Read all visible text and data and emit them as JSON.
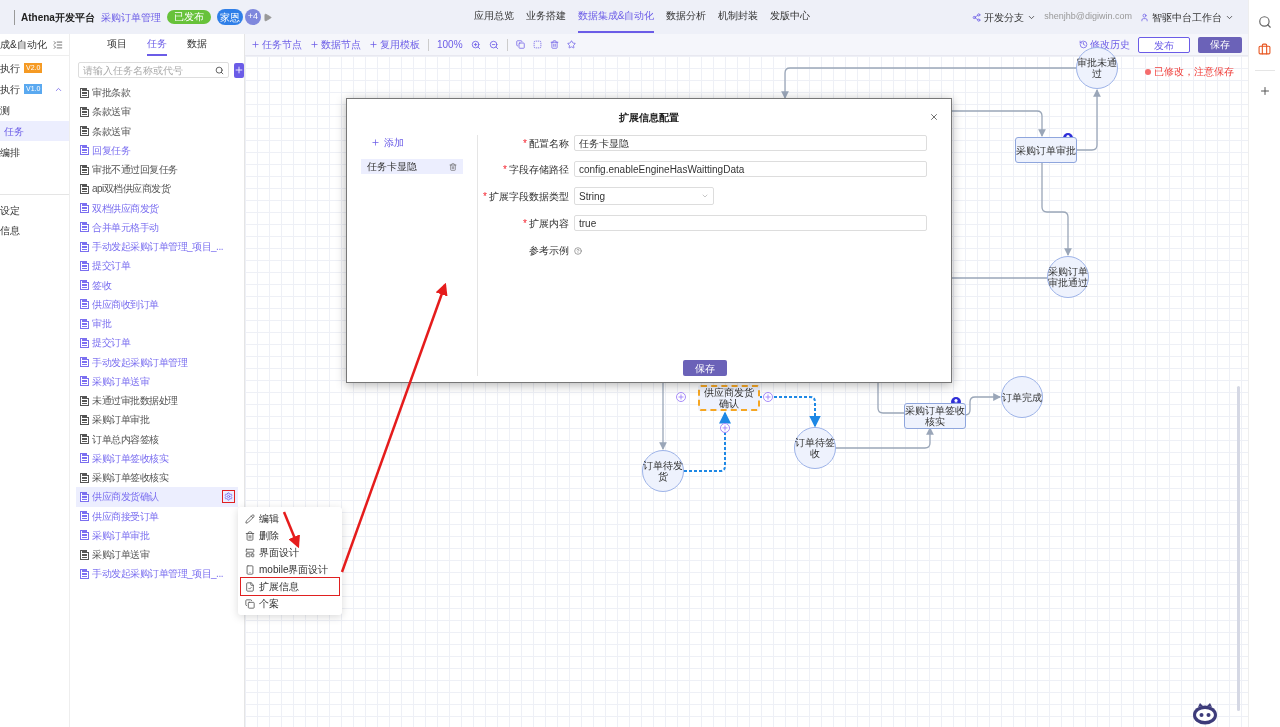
{
  "top_bar": {
    "brand": "Athena开发平台",
    "app_name": "采购订单管理",
    "status": "已发布",
    "avatar": "家恩",
    "more_count": "+4",
    "nav": [
      {
        "label": "应用总览",
        "selected": false
      },
      {
        "label": "业务搭建",
        "selected": false
      },
      {
        "label": "数据集成&自动化",
        "selected": true
      },
      {
        "label": "数据分析",
        "selected": false
      },
      {
        "label": "机制封装",
        "selected": false
      },
      {
        "label": "发版中心",
        "selected": false
      }
    ],
    "branch": "开发分支",
    "user": "shenjhb@digiwin.com",
    "workspace": "智驱中台工作台"
  },
  "sidebar": {
    "title": "成&自动化",
    "items": [
      {
        "label": "执行",
        "badge": "V2.0",
        "color": "#f59a23",
        "selected": false,
        "expanded": false
      },
      {
        "label": "执行",
        "badge": "V1.0",
        "color": "#5aa9f0",
        "selected": false,
        "expanded": true
      },
      {
        "label": "测",
        "selected": false
      },
      {
        "label": "任务",
        "selected": true
      },
      {
        "label": "编排",
        "selected": false
      }
    ],
    "bottom_items": [
      "设定",
      "信息"
    ]
  },
  "task_panel": {
    "tabs": [
      {
        "label": "项目",
        "selected": false
      },
      {
        "label": "任务",
        "selected": true
      },
      {
        "label": "数据",
        "selected": false
      }
    ],
    "search": {
      "placeholder": "请输入任务名称或代号"
    },
    "items": [
      {
        "label": "审批条款",
        "color": "#555555",
        "selected": false
      },
      {
        "label": "条款送审",
        "color": "#555555",
        "selected": false
      },
      {
        "label": "条款送审",
        "color": "#555555",
        "selected": false
      },
      {
        "label": "回复任务",
        "color": "#7b6ff0",
        "selected": false
      },
      {
        "label": "审批不通过回复任务",
        "color": "#555555",
        "selected": false
      },
      {
        "label": "api双档供应商发货",
        "color": "#555555",
        "selected": false
      },
      {
        "label": "双档供应商发货",
        "color": "#7b6ff0",
        "selected": false
      },
      {
        "label": "合并单元格手动",
        "color": "#7b6ff0",
        "selected": false
      },
      {
        "label": "手动发起采购订单管理_项目_...",
        "color": "#7b6ff0",
        "selected": false
      },
      {
        "label": "提交订单",
        "color": "#7b6ff0",
        "selected": false
      },
      {
        "label": "签收",
        "color": "#7b6ff0",
        "selected": false
      },
      {
        "label": "供应商收到订单",
        "color": "#7b6ff0",
        "selected": false
      },
      {
        "label": "审批",
        "color": "#7b6ff0",
        "selected": false
      },
      {
        "label": "提交订单",
        "color": "#7b6ff0",
        "selected": false
      },
      {
        "label": "手动发起采购订单管理",
        "color": "#7b6ff0",
        "selected": false
      },
      {
        "label": "采购订单送审",
        "color": "#7b6ff0",
        "selected": false
      },
      {
        "label": "未通过审批数据处理",
        "color": "#555555",
        "selected": false
      },
      {
        "label": "采购订单审批",
        "color": "#555555",
        "selected": false
      },
      {
        "label": "订单总内容签核",
        "color": "#555555",
        "selected": false
      },
      {
        "label": "采购订单签收核实",
        "color": "#7b6ff0",
        "selected": false
      },
      {
        "label": "采购订单签收核实",
        "color": "#555555",
        "selected": false
      },
      {
        "label": "供应商发货确认",
        "color": "#7b6ff0",
        "selected": true
      },
      {
        "label": "供应商接受订单",
        "color": "#7b6ff0",
        "selected": false
      },
      {
        "label": "采购订单审批",
        "color": "#7b6ff0",
        "selected": false
      },
      {
        "label": "采购订单送审",
        "color": "#555555",
        "selected": false
      },
      {
        "label": "手动发起采购订单管理_项目_...",
        "color": "#7b6ff0",
        "selected": false
      }
    ]
  },
  "context_menu": {
    "anchor_highlighted": true,
    "items": [
      {
        "label": "编辑",
        "kind": "edit",
        "highlighted": false
      },
      {
        "label": "删除",
        "kind": "delete",
        "highlighted": false
      },
      {
        "label": "界面设计",
        "kind": "layout",
        "highlighted": false
      },
      {
        "label": "mobile界面设计",
        "kind": "mobile",
        "highlighted": false
      },
      {
        "label": "扩展信息",
        "kind": "extend",
        "highlighted": true
      },
      {
        "label": "个案",
        "kind": "copy",
        "highlighted": false
      }
    ]
  },
  "toolbar": {
    "add_buttons": [
      "任务节点",
      "数据节点",
      "复用模板"
    ],
    "zoom": "100%",
    "history": "修改历史",
    "publish": "发布",
    "save": "保存"
  },
  "canvas": {
    "status": "已修改，注意保存",
    "nodes": [
      {
        "kind": "circle",
        "label": "审批未通过",
        "selected": false
      },
      {
        "kind": "task",
        "label": "采购订单审批",
        "selected": false
      },
      {
        "kind": "circle",
        "label": "采购订单审批通过",
        "selected": false
      },
      {
        "kind": "task",
        "label": "供应商发货确认",
        "selected": true
      },
      {
        "kind": "circle",
        "label": "订单待发货",
        "selected": false
      },
      {
        "kind": "circle",
        "label": "订单待签收",
        "selected": false
      },
      {
        "kind": "task",
        "label": "采购订单签收核实",
        "selected": false
      },
      {
        "kind": "circle",
        "label": "订单完成",
        "selected": false
      }
    ]
  },
  "dialog": {
    "title": "扩展信息配置",
    "add_label": "添加",
    "configs": [
      {
        "label": "任务卡显隐",
        "selected": true
      }
    ],
    "fields": [
      {
        "label": "配置名称",
        "required": true,
        "kind": "input",
        "value": "任务卡显隐"
      },
      {
        "label": "字段存储路径",
        "required": true,
        "kind": "input",
        "value": "config.enableEngineHasWaittingData"
      },
      {
        "label": "扩展字段数据类型",
        "required": true,
        "kind": "select",
        "value": "String"
      },
      {
        "label": "扩展内容",
        "required": true,
        "kind": "input",
        "value": "true"
      }
    ],
    "required_mark": "*",
    "example_label": "参考示例",
    "save": "保存"
  }
}
